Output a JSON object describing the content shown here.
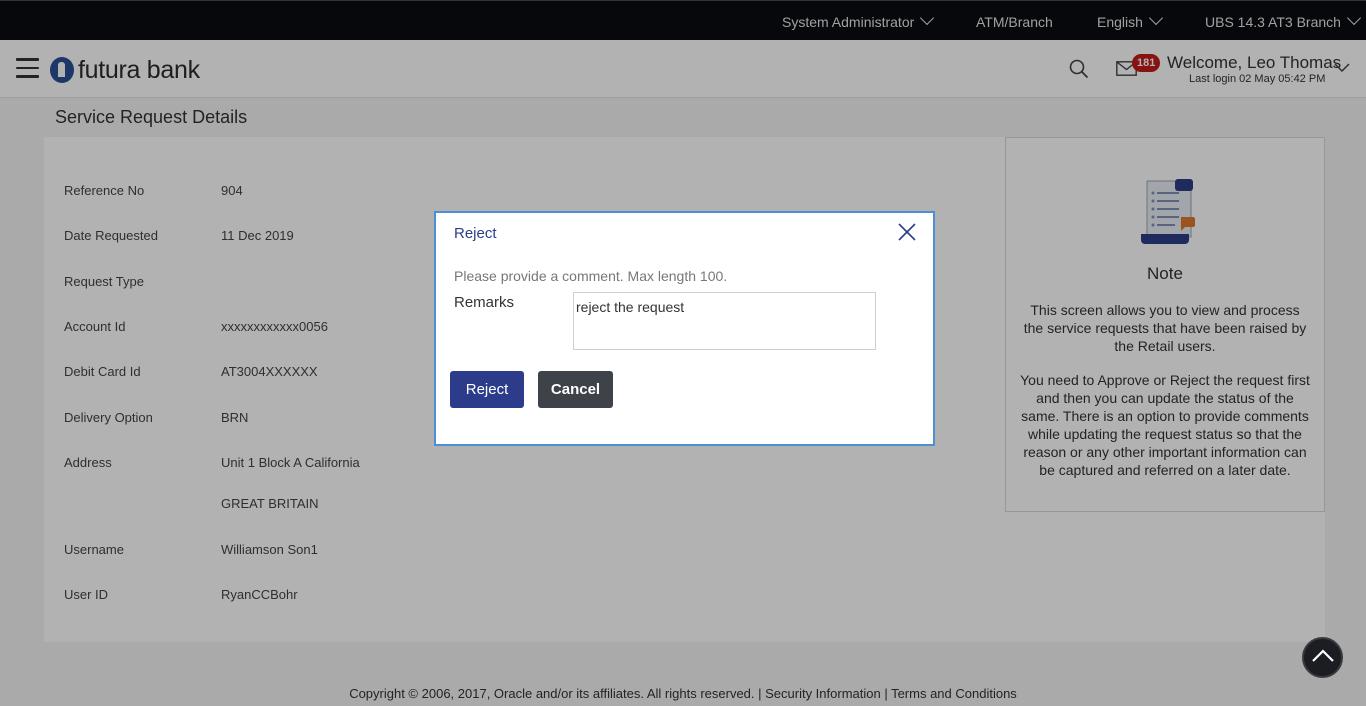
{
  "topbar": {
    "role": "System Administrator",
    "atm_branch": "ATM/Branch",
    "language": "English",
    "branch": "UBS 14.3 AT3 Branch"
  },
  "header": {
    "brand": "futura bank",
    "badge_count": "181",
    "welcome": "Welcome, Leo Thomas",
    "last_login": "Last login 02 May 05:42 PM"
  },
  "page": {
    "title": "Service Request Details"
  },
  "details": [
    {
      "label": "Reference No",
      "value": "904"
    },
    {
      "label": "Date Requested",
      "value": "11 Dec 2019"
    },
    {
      "label": "Request Type",
      "value": ""
    },
    {
      "label": "Account Id",
      "value": "xxxxxxxxxxxx0056"
    },
    {
      "label": "Debit Card Id",
      "value": "AT3004XXXXXX"
    },
    {
      "label": "Delivery Option",
      "value": "BRN"
    },
    {
      "label": "Address",
      "value": "Unit 1 Block A California"
    },
    {
      "label": "",
      "value": "GREAT BRITAIN"
    },
    {
      "label": "Username",
      "value": "Williamson Son1"
    },
    {
      "label": "User ID",
      "value": "RyanCCBohr"
    }
  ],
  "note": {
    "title": "Note",
    "paragraph1": "This screen allows you to view and process the service requests that have been raised by the Retail users.",
    "paragraph2": "You need to Approve or Reject the request first and then you can update the status of the same. There is an option to provide comments while updating the request status so that the reason or any other important information can be captured and referred on a later date."
  },
  "modal": {
    "title": "Reject",
    "hint": "Please provide a comment. Max length 100.",
    "remarks_label": "Remarks",
    "remarks_value": "reject the request",
    "reject_label": "Reject",
    "cancel_label": "Cancel"
  },
  "footer": {
    "text": "Copyright © 2006, 2017, Oracle and/or its affiliates. All rights reserved. | Security Information | Terms and Conditions"
  }
}
